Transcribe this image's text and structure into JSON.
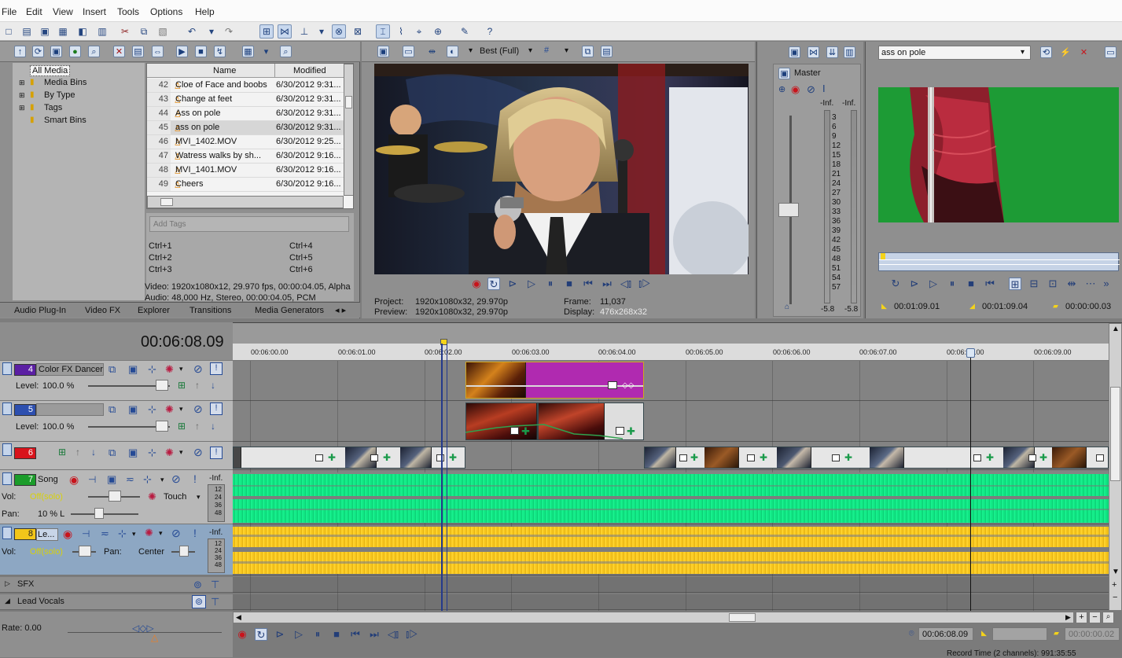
{
  "menu": [
    "File",
    "Edit",
    "View",
    "Insert",
    "Tools",
    "Options",
    "Help"
  ],
  "explorer": {
    "tree": [
      "All Media",
      "Media Bins",
      "By Type",
      "Tags",
      "Smart Bins"
    ],
    "columns": {
      "name": "Name",
      "modified": "Modified"
    },
    "rows": [
      {
        "num": "42",
        "name": "Cloe of Face and boobs",
        "modified": "6/30/2012 9:31..."
      },
      {
        "num": "43",
        "name": "Change at feet",
        "modified": "6/30/2012 9:31..."
      },
      {
        "num": "44",
        "name": "Ass on pole",
        "modified": "6/30/2012 9:31..."
      },
      {
        "num": "45",
        "name": "ass on pole",
        "modified": "6/30/2012 9:31..."
      },
      {
        "num": "46",
        "name": "MVI_1402.MOV",
        "modified": "6/30/2012 9:25..."
      },
      {
        "num": "47",
        "name": "Watress walks by sh...",
        "modified": "6/30/2012 9:16..."
      },
      {
        "num": "48",
        "name": "MVI_1401.MOV",
        "modified": "6/30/2012 9:16..."
      },
      {
        "num": "49",
        "name": "Cheers",
        "modified": "6/30/2012 9:16..."
      }
    ],
    "tags_placeholder": "Add Tags",
    "shortcuts": [
      [
        "Ctrl+1",
        "Ctrl+4"
      ],
      [
        "Ctrl+2",
        "Ctrl+5"
      ],
      [
        "Ctrl+3",
        "Ctrl+6"
      ]
    ],
    "video_info": "Video: 1920x1080x12, 29.970 fps, 00:00:04.05, Alpha",
    "audio_info": "Audio: 48,000 Hz, Stereo, 00:00:04.05, PCM"
  },
  "tabs": [
    "Audio Plug-In",
    "Video FX",
    "Explorer",
    "Transitions",
    "Media Generators"
  ],
  "preview": {
    "quality": "Best (Full)",
    "project_label": "Project:",
    "project_value": "1920x1080x32, 29.970p",
    "preview_label": "Preview:",
    "preview_value": "1920x1080x32, 29.970p",
    "frame_label": "Frame:",
    "frame_value": "11,037",
    "display_label": "Display:",
    "display_value": "476x268x32"
  },
  "master": {
    "title": "Master",
    "peak_left": "-Inf.",
    "peak_right": "-Inf.",
    "scale": [
      "3",
      "6",
      "9",
      "12",
      "15",
      "18",
      "21",
      "24",
      "27",
      "30",
      "33",
      "36",
      "39",
      "42",
      "45",
      "48",
      "51",
      "54",
      "57"
    ],
    "bottom_left": "-5.8",
    "bottom_right": "-5.8"
  },
  "trimmer": {
    "clip": "ass on pole",
    "time_in": "00:01:09.01",
    "time_out": "00:01:09.04",
    "duration": "00:00:00.03"
  },
  "timeline": {
    "timecode": "00:06:08.09",
    "ruler": [
      "00:06:00.00",
      "00:06:01.00",
      "00:06:02.00",
      "00:06:03.00",
      "00:06:04.00",
      "00:06:05.00",
      "00:06:06.00",
      "00:06:07.00",
      "00:06:08.00",
      "00:06:09.00"
    ],
    "tracks": [
      {
        "num": "4",
        "name": "Color FX Dancer",
        "level_label": "Level:",
        "level": "100.0 %"
      },
      {
        "num": "5",
        "name": "",
        "level_label": "Level:",
        "level": "100.0 %"
      },
      {
        "num": "6",
        "name": ""
      },
      {
        "num": "7",
        "name": "Song",
        "vol_label": "Vol:",
        "vol": "Off(solo)",
        "pan_label": "Pan:",
        "pan": "10 % L",
        "automation": "Touch",
        "peak": "-Inf.",
        "meter": [
          "12",
          "24",
          "36",
          "48"
        ]
      },
      {
        "num": "8",
        "name": "Le...",
        "vol_label": "Vol:",
        "vol": "Off(solo)",
        "pan_label": "Pan:",
        "pan": "Center",
        "peak": "-Inf.",
        "meter": [
          "12",
          "24",
          "36",
          "48"
        ]
      }
    ],
    "buses": [
      "SFX",
      "Lead Vocals"
    ],
    "rate_label": "Rate: 0.00",
    "bottom_timecode": "00:06:08.09",
    "bottom_right_time": "00:00:00.02",
    "record_time": "Record Time (2 channels): 991:35:55"
  },
  "colors": {
    "purple_clip": "#b02ab0",
    "green_wave": "#10e582",
    "yellow_wave": "#f6c51e",
    "track4": "#5b1fa3",
    "track5": "#2d4faf",
    "track6": "#d8141c",
    "track7": "#1b9c2a",
    "track8": "#f2c61a"
  }
}
